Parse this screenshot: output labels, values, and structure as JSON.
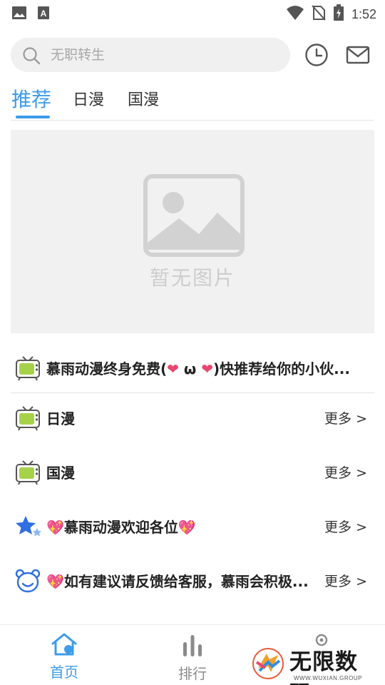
{
  "status_bar": {
    "time": "1:52",
    "icons": [
      "image-icon",
      "font-a-icon",
      "wifi-icon",
      "no-sim-icon",
      "battery-charging-icon"
    ]
  },
  "search": {
    "placeholder": "无职转生",
    "icons": [
      "search-icon",
      "history-clock-icon",
      "mail-icon"
    ]
  },
  "tabs": [
    {
      "label": "推荐",
      "active": true
    },
    {
      "label": "日漫",
      "active": false
    },
    {
      "label": "国漫",
      "active": false
    }
  ],
  "banner": {
    "placeholder_text": "暂无图片"
  },
  "notice": {
    "text_before": "慕雨动漫终身免费(",
    "heart_left": "❤",
    "omega": " ω ",
    "heart_right": "❤",
    "text_after": ")快推荐给你的小伙..."
  },
  "sections": [
    {
      "title": "日漫",
      "more": "更多 >",
      "icon": "tv-icon"
    },
    {
      "title": "国漫",
      "more": "更多 >",
      "icon": "tv-icon"
    },
    {
      "title": "💖慕雨动漫欢迎各位💖",
      "more": "更多 >",
      "icon": "star-icon"
    },
    {
      "title": "💖如有建议请反馈给客服，慕雨会积极...",
      "more": "更多 >",
      "icon": "bear-icon"
    }
  ],
  "bottom_nav": [
    {
      "label": "首页",
      "icon": "home-icon",
      "active": true
    },
    {
      "label": "排行",
      "icon": "ranking-bars-icon",
      "active": false
    }
  ],
  "watermark": {
    "text": "无限数码",
    "subtext": "WWW.WUXIAN.GROUP"
  },
  "colors": {
    "accent": "#3d9be9",
    "heart": "#e8476f",
    "tv_green": "#a6d24a"
  }
}
